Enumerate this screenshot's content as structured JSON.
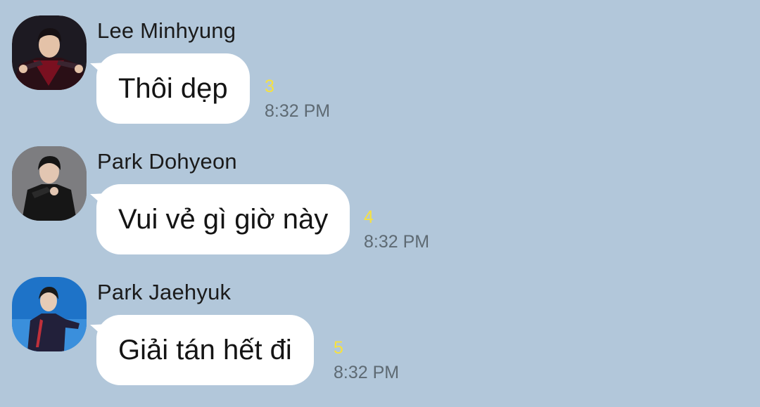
{
  "colors": {
    "background": "#b2c7da",
    "bubble": "#ffffff",
    "unread": "#f7e23e",
    "time": "#5e6a73"
  },
  "messages": [
    {
      "sender": "Lee Minhyung",
      "text": "Thôi dẹp",
      "unread": "3",
      "time": "8:32 PM",
      "avatar_icon": "person-dark-jersey-icon"
    },
    {
      "sender": "Park Dohyeon",
      "text": "Vui vẻ gì giờ này",
      "unread": "4",
      "time": "8:32 PM",
      "avatar_icon": "person-black-jacket-icon"
    },
    {
      "sender": "Park Jaehyuk",
      "text": "Giải tán hết đi",
      "unread": "5",
      "time": "8:32 PM",
      "avatar_icon": "person-blue-stage-icon"
    }
  ]
}
